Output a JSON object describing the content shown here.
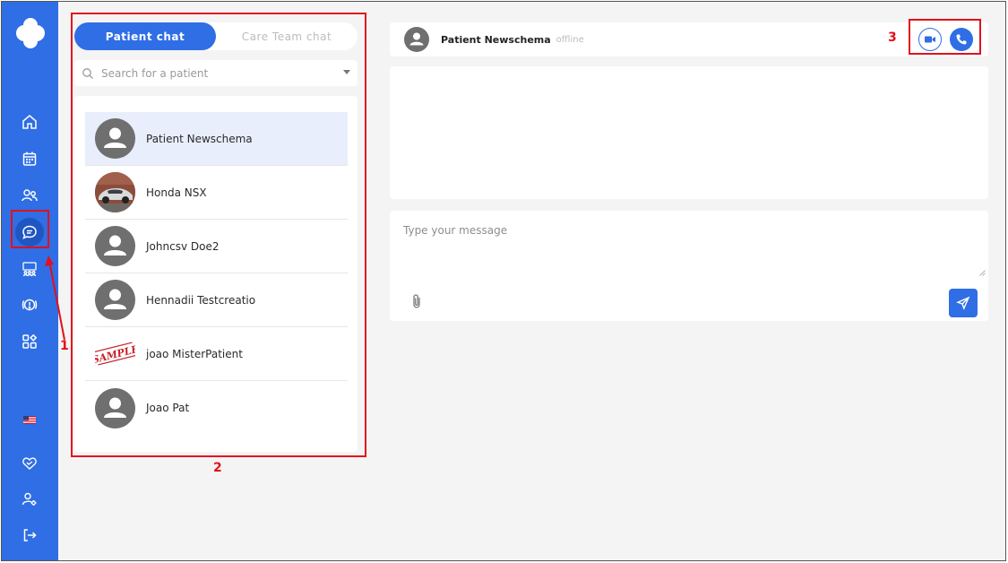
{
  "tabs": {
    "patient_chat": "Patient chat",
    "care_team_chat": "Care Team chat"
  },
  "search": {
    "placeholder": "Search for a patient"
  },
  "patients": [
    {
      "name": "Patient Newschema",
      "avatar": "default-avatar"
    },
    {
      "name": "Honda NSX",
      "avatar": "car-photo"
    },
    {
      "name": "Johncsv Doe2",
      "avatar": "default-avatar"
    },
    {
      "name": "Hennadii Testcreatio",
      "avatar": "default-avatar"
    },
    {
      "name": "joao MisterPatient",
      "avatar": "sample-stamp",
      "avatar_text": "SAMPLE"
    },
    {
      "name": "Joao Pat",
      "avatar": "default-avatar"
    }
  ],
  "chat": {
    "patient_name": "Patient Newschema",
    "status": "offline",
    "message_placeholder": "Type your message"
  },
  "annotations": [
    "1",
    "2",
    "3"
  ],
  "sidebar": {
    "icons": [
      "home-icon",
      "calendar-icon",
      "patients-icon",
      "chat-icon",
      "care-team-icon",
      "alerts-icon",
      "apps-icon",
      "us-flag-icon",
      "support-icon",
      "user-settings-icon",
      "logout-icon"
    ]
  },
  "colors": {
    "primary": "#2f6ee5",
    "annotation": "#e3101a",
    "selected_row": "#e8eefb",
    "background": "#f4f4f4"
  }
}
